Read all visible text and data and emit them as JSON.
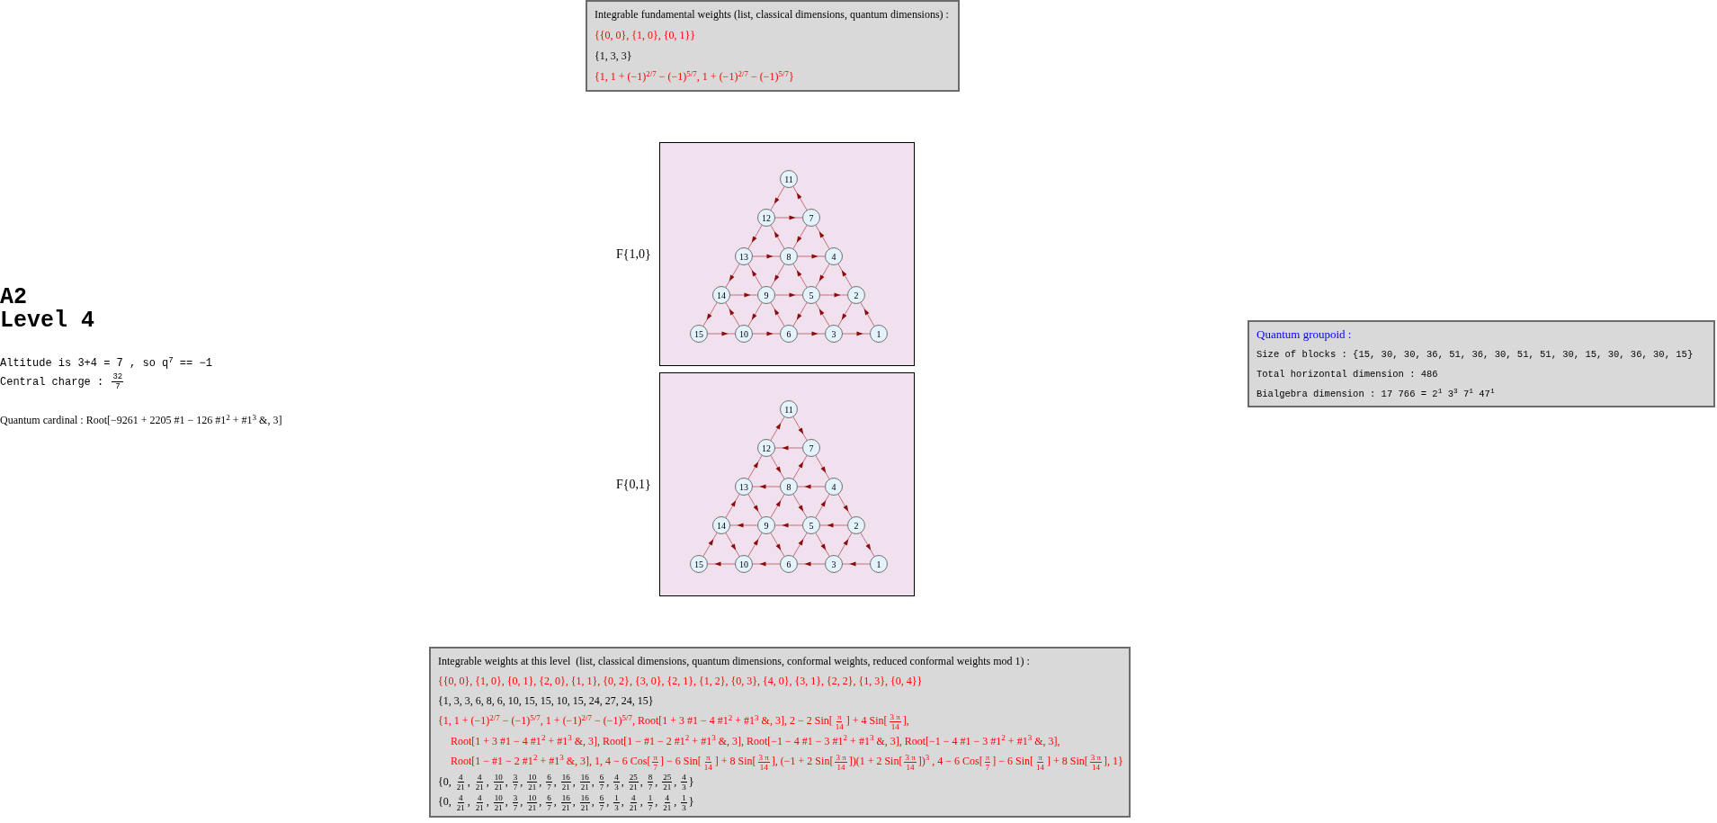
{
  "left": [
    {
      "kind": "heading",
      "parts": [
        "A2"
      ]
    },
    {
      "kind": "heading",
      "parts": [
        "Level 4"
      ]
    },
    {
      "kind": "code",
      "parts": [
        "Altitude is 3+4 = 7 , so q$^{7}$ == −1"
      ]
    },
    {
      "kind": "code",
      "parts": [
        "Central charge : ",
        {
          "num": "32",
          "den": "7"
        }
      ]
    },
    {
      "kind": "math",
      "parts": [
        "Quantum cardinal : Root[−9261 + 2205 #1 − 126 #1$^{2}$ + #1$^{3}$ &, 3]"
      ]
    }
  ],
  "fundamental_weights": {
    "title": {
      "kind": "math",
      "parts": [
        "Integrable fundamental weights (list, classical dimensions, quantum dimensions) :"
      ]
    },
    "lines": [
      {
        "highlighted": true,
        "kind": "math",
        "parts": [
          "{{0, 0}, {1, 0}, {0, 1}}"
        ]
      },
      {
        "highlighted": false,
        "kind": "math",
        "parts": [
          "{1, 3, 3}"
        ]
      },
      {
        "highlighted": true,
        "kind": "math",
        "parts": [
          "{1, 1 + (−1)$^{2/7}$ − (−1)$^{5/7}$, 1 + (−1)$^{2/7}$ − (−1)$^{5/7}$}"
        ]
      }
    ]
  },
  "graphs": [
    {
      "label": "F{1,0}",
      "rows": [
        [
          {
            "label": "11",
            "out_sw": true
          }
        ],
        [
          {
            "label": "12",
            "out_e": true,
            "out_sw": true
          },
          {
            "label": "7",
            "out_nw": true,
            "out_sw": true
          }
        ],
        [
          {
            "label": "13",
            "out_e": true,
            "out_sw": true
          },
          {
            "label": "8",
            "out_nw": true,
            "out_e": true,
            "out_sw": true
          },
          {
            "label": "4",
            "out_nw": true,
            "out_sw": true
          }
        ],
        [
          {
            "label": "14",
            "out_e": true,
            "out_sw": true
          },
          {
            "label": "9",
            "out_nw": true,
            "out_e": true,
            "out_sw": true
          },
          {
            "label": "5",
            "out_nw": true,
            "out_e": true,
            "out_sw": true
          },
          {
            "label": "2",
            "out_nw": true,
            "out_sw": true
          }
        ],
        [
          {
            "label": "15",
            "out_e": true
          },
          {
            "label": "10",
            "out_nw": true,
            "out_e": true
          },
          {
            "label": "6",
            "out_nw": true,
            "out_e": true
          },
          {
            "label": "3",
            "out_nw": true,
            "out_e": true
          },
          {
            "label": "1",
            "out_nw": true
          }
        ]
      ]
    },
    {
      "label": "F{0,1}",
      "rows": [
        [
          {
            "label": "11",
            "out_se": true
          }
        ],
        [
          {
            "label": "12",
            "out_ne": true,
            "out_se": true
          },
          {
            "label": "7",
            "out_w": true,
            "out_se": true
          }
        ],
        [
          {
            "label": "13",
            "out_ne": true,
            "out_se": true
          },
          {
            "label": "8",
            "out_ne": true,
            "out_w": true,
            "out_se": true
          },
          {
            "label": "4",
            "out_w": true,
            "out_se": true
          }
        ],
        [
          {
            "label": "14",
            "out_ne": true,
            "out_se": true
          },
          {
            "label": "9",
            "out_ne": true,
            "out_w": true,
            "out_se": true
          },
          {
            "label": "5",
            "out_ne": true,
            "out_w": true,
            "out_se": true
          },
          {
            "label": "2",
            "out_w": true,
            "out_se": true
          }
        ],
        [
          {
            "label": "15",
            "out_ne": true
          },
          {
            "label": "10",
            "out_ne": true,
            "out_w": true
          },
          {
            "label": "6",
            "out_ne": true,
            "out_w": true
          },
          {
            "label": "3",
            "out_ne": true,
            "out_w": true
          },
          {
            "label": "1",
            "out_w": true
          }
        ]
      ]
    }
  ],
  "quantum_groupoid": {
    "title": {
      "kind": "accent",
      "parts": [
        "Quantum groupoid :"
      ]
    },
    "lines": [
      {
        "highlighted": false,
        "kind": "code",
        "parts": [
          "Size of blocks : {15, 30, 30, 36, 51, 36, 30, 51, 51, 30, 15, 30, 36, 30, 15}"
        ]
      },
      {
        "highlighted": false,
        "kind": "code",
        "parts": [
          "Total horizontal dimension : 486"
        ]
      },
      {
        "highlighted": false,
        "kind": "code",
        "parts": [
          "Bialgebra dimension : 17 766 = 2$^{1}$ 3$^{3}$ 7$^{1}$ 47$^{1}$"
        ]
      }
    ]
  },
  "level_weights": {
    "title": {
      "kind": "math",
      "parts": [
        "Integrable weights at this level  (list, classical dimensions, quantum dimensions, conformal weights, reduced conformal weights mod 1) :"
      ]
    },
    "lines": [
      {
        "highlighted": true,
        "kind": "math",
        "parts": [
          "{{0, 0}, {1, 0}, {0, 1}, {2, 0}, {1, 1}, {0, 2}, {3, 0}, {2, 1}, {1, 2}, {0, 3}, {4, 0}, {3, 1}, {2, 2}, {1, 3}, {0, 4}}"
        ]
      },
      {
        "highlighted": false,
        "kind": "math",
        "parts": [
          "{1, 3, 3, 6, 8, 6, 10, 15, 15, 10, 15, 24, 27, 24, 15}"
        ]
      },
      {
        "highlighted": true,
        "kind": "math",
        "parts": [
          "{1, 1 + (−1)$^{2/7}$ − (−1)$^{5/7}$, 1 + (−1)$^{2/7}$ − (−1)$^{5/7}$, Root[1 + 3 #1 − 4 #1$^{2}$ + #1$^{3}$ &, 3], 2 − 2 Sin[",
          {
            "num": "π",
            "den": "14"
          },
          "] + 4 Sin[",
          {
            "num": "3 π",
            "den": "14"
          },
          "],"
        ]
      },
      {
        "highlighted": true,
        "kind": "math-indent",
        "parts": [
          "Root[1 + 3 #1 − 4 #1$^{2}$ + #1$^{3}$ &, 3], Root[1 − #1 − 2 #1$^{2}$ + #1$^{3}$ &, 3], Root[−1 − 4 #1 − 3 #1$^{2}$ + #1$^{3}$ &, 3], Root[−1 − 4 #1 − 3 #1$^{2}$ + #1$^{3}$ &, 3],"
        ]
      },
      {
        "highlighted": true,
        "kind": "math-indent",
        "parts": [
          "Root[1 − #1 − 2 #1$^{2}$ + #1$^{3}$ &, 3], 1, 4 − 6 Cos[",
          {
            "num": "π",
            "den": "7"
          },
          "] − 6 Sin[",
          {
            "num": "π",
            "den": "14"
          },
          "] + 8 Sin[",
          {
            "num": "3 π",
            "den": "14"
          },
          "], (−1 + 2 Sin[",
          {
            "num": "3 π",
            "den": "14"
          },
          "])(1 + 2 Sin[",
          {
            "num": "3 π",
            "den": "14"
          },
          "])$^{3}$ , 4 − 6 Cos[",
          {
            "num": "π",
            "den": "7"
          },
          "] − 6 Sin[",
          {
            "num": "π",
            "den": "14"
          },
          "] + 8 Sin[",
          {
            "num": "3 π",
            "den": "14"
          },
          "], 1}"
        ]
      },
      {
        "highlighted": false,
        "kind": "math",
        "parts": [
          "{0, ",
          {
            "num": "4",
            "den": "21"
          },
          ", ",
          {
            "num": "4",
            "den": "21"
          },
          ", ",
          {
            "num": "10",
            "den": "21"
          },
          ", ",
          {
            "num": "3",
            "den": "7"
          },
          ", ",
          {
            "num": "10",
            "den": "21"
          },
          ", ",
          {
            "num": "6",
            "den": "7"
          },
          ", ",
          {
            "num": "16",
            "den": "21"
          },
          ", ",
          {
            "num": "16",
            "den": "21"
          },
          ", ",
          {
            "num": "6",
            "den": "7"
          },
          ", ",
          {
            "num": "4",
            "den": "3"
          },
          ", ",
          {
            "num": "25",
            "den": "21"
          },
          ", ",
          {
            "num": "8",
            "den": "7"
          },
          ", ",
          {
            "num": "25",
            "den": "21"
          },
          ", ",
          {
            "num": "4",
            "den": "3"
          },
          "}"
        ]
      },
      {
        "highlighted": false,
        "kind": "math",
        "parts": [
          "{0, ",
          {
            "num": "4",
            "den": "21"
          },
          ", ",
          {
            "num": "4",
            "den": "21"
          },
          ", ",
          {
            "num": "10",
            "den": "21"
          },
          ", ",
          {
            "num": "3",
            "den": "7"
          },
          ", ",
          {
            "num": "10",
            "den": "21"
          },
          ", ",
          {
            "num": "6",
            "den": "7"
          },
          ", ",
          {
            "num": "16",
            "den": "21"
          },
          ", ",
          {
            "num": "16",
            "den": "21"
          },
          ", ",
          {
            "num": "6",
            "den": "7"
          },
          ", ",
          {
            "num": "1",
            "den": "3"
          },
          ", ",
          {
            "num": "4",
            "den": "21"
          },
          ", ",
          {
            "num": "1",
            "den": "7"
          },
          ", ",
          {
            "num": "4",
            "den": "21"
          },
          ", ",
          {
            "num": "1",
            "den": "3"
          },
          "}"
        ]
      }
    ]
  }
}
